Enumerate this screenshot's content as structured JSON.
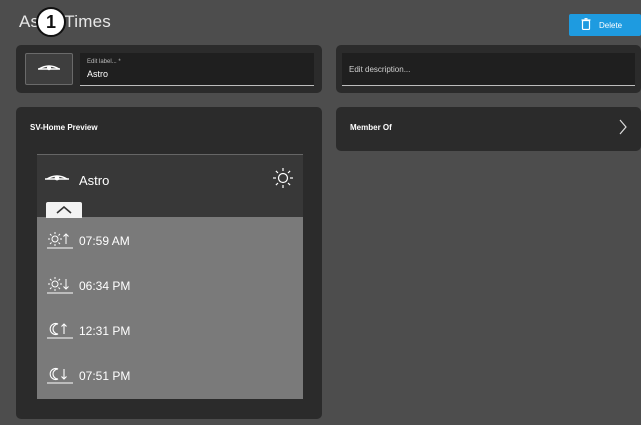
{
  "header": {
    "title": "Astro Times",
    "step_badge": "1",
    "delete_label": "Delete"
  },
  "label_card": {
    "icon": "astro-icon",
    "field_label": "Edit label... *",
    "field_value": "Astro"
  },
  "description_card": {
    "placeholder": "Edit description..."
  },
  "preview_card": {
    "heading": "SV-Home Preview",
    "device_label": "Astro",
    "times": [
      {
        "icon": "sunrise-icon",
        "value": "07:59 AM"
      },
      {
        "icon": "sunset-icon",
        "value": "06:34 PM"
      },
      {
        "icon": "moonrise-icon",
        "value": "12:31 PM"
      },
      {
        "icon": "moonset-icon",
        "value": "07:51 PM"
      }
    ]
  },
  "member_card": {
    "heading": "Member Of"
  },
  "colors": {
    "background": "#4d4d4d",
    "card": "#2b2b2b",
    "accent": "#1e9be0",
    "preview_body": "#7a7a7a"
  }
}
